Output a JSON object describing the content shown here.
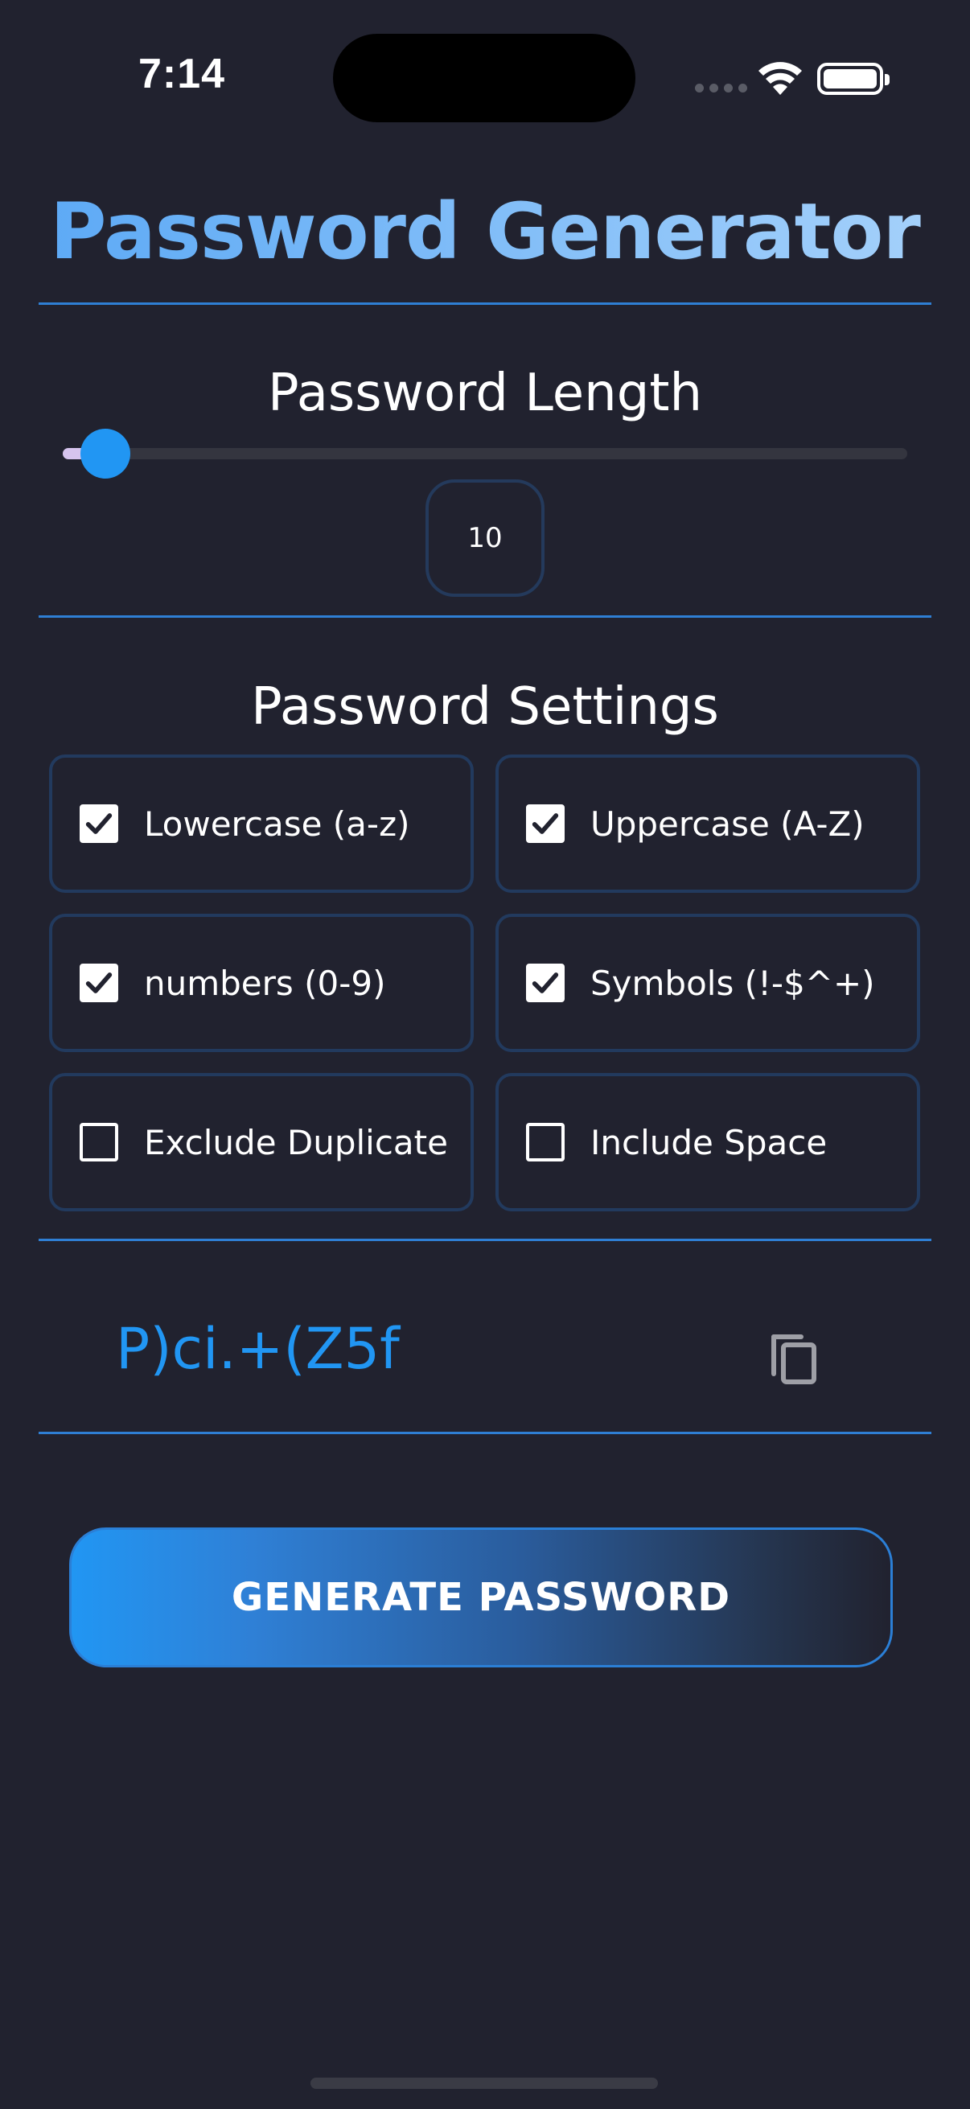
{
  "status_bar": {
    "time": "7:14"
  },
  "app": {
    "title": "Password Generator"
  },
  "length_section": {
    "heading": "Password Length",
    "slider_fraction": 0.05,
    "value": "10"
  },
  "settings_section": {
    "heading": "Password Settings",
    "options": [
      {
        "label": "Lowercase (a-z)",
        "checked": true
      },
      {
        "label": "Uppercase (A-Z)",
        "checked": true
      },
      {
        "label": "numbers (0-9)",
        "checked": true
      },
      {
        "label": "Symbols (!-$^+)",
        "checked": true
      },
      {
        "label": "Exclude Duplicate",
        "checked": false
      },
      {
        "label": "Include Space",
        "checked": false
      }
    ]
  },
  "result": {
    "password": "P)ci.+(Z5f",
    "copy_icon": "copy-icon"
  },
  "actions": {
    "generate_label": "GENERATE PASSWORD"
  },
  "colors": {
    "background": "#21222f",
    "accent": "#2196f3",
    "divider": "#2f7fd4",
    "border": "#223a5e",
    "title_gradient_start": "#5aa8f5",
    "title_gradient_end": "#a7d2fb"
  }
}
